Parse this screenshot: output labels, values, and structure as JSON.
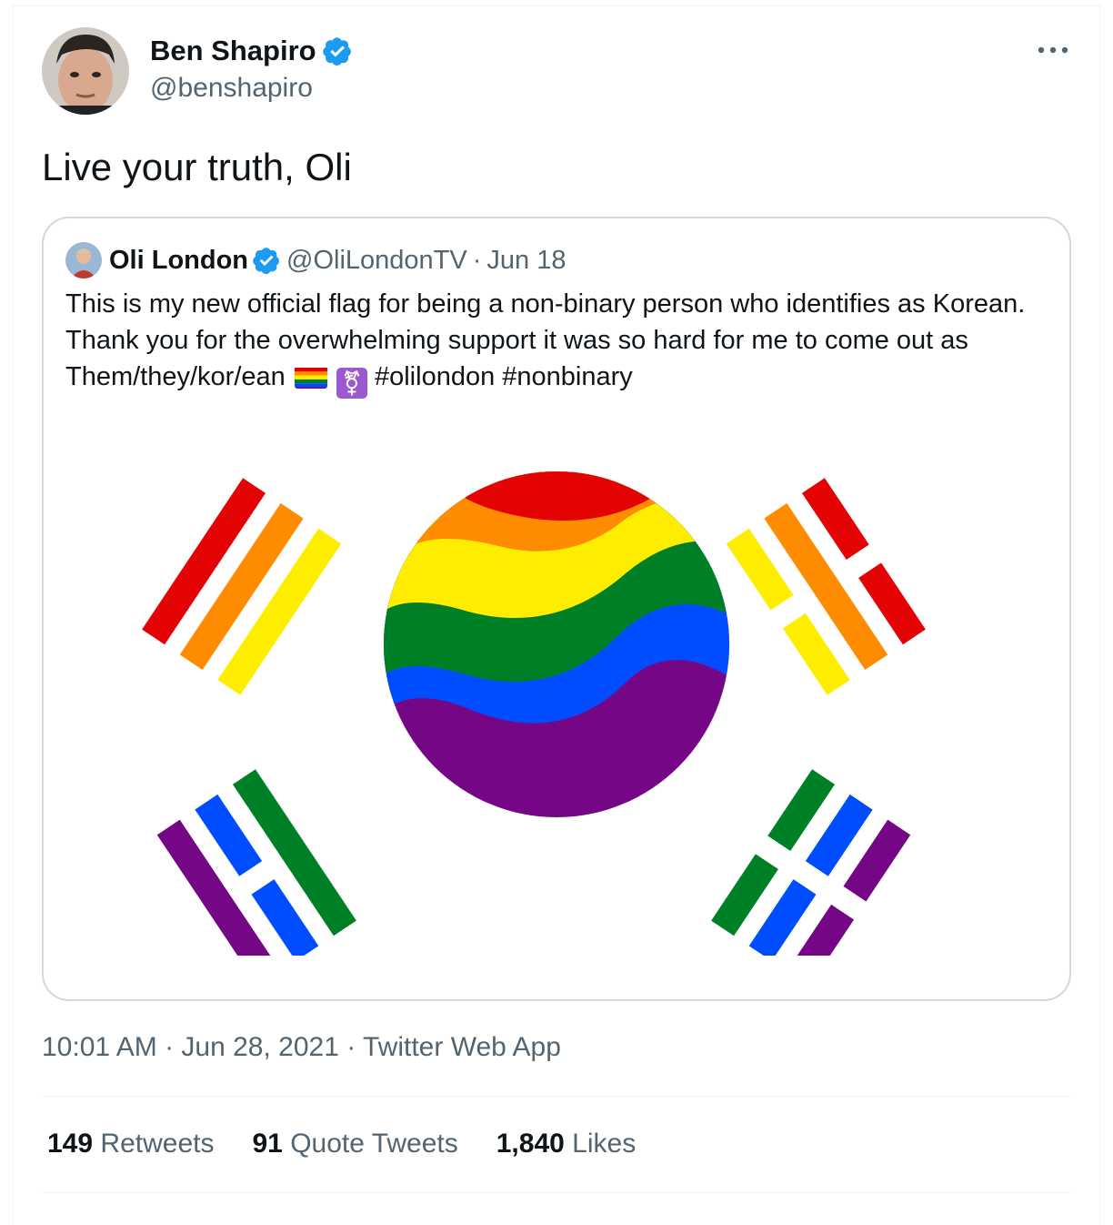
{
  "tweet": {
    "author_name": "Ben Shapiro",
    "author_handle": "@benshapiro",
    "text": "Live your truth, Oli",
    "timestamp": "10:01 AM · Jun 28, 2021 · Twitter Web App",
    "stats": {
      "retweets_count": "149",
      "retweets_label": "Retweets",
      "quotes_count": "91",
      "quotes_label": "Quote Tweets",
      "likes_count": "1,840",
      "likes_label": "Likes"
    }
  },
  "quoted": {
    "author_name": "Oli London",
    "author_handle": "@OliLondonTV",
    "separator": "·",
    "date": "Jun 18",
    "text_main": "This is my new official flag for being a non-binary person who identifies as Korean.  Thank you for the overwhelming support it was so hard for me to come out as Them/they/kor/ean",
    "hashtags": "#olilondon #nonbinary",
    "trans_symbol": "⚧"
  },
  "icons": {
    "verified": "verified-badge-icon",
    "more": "more-options-icon"
  },
  "colors": {
    "verified_blue": "#1d9bf0",
    "secondary_text": "#536471",
    "border": "#cfd9de",
    "red": "#e40303",
    "orange": "#ff8c00",
    "yellow": "#ffed00",
    "green": "#008026",
    "blue": "#004dff",
    "purple": "#750787"
  }
}
